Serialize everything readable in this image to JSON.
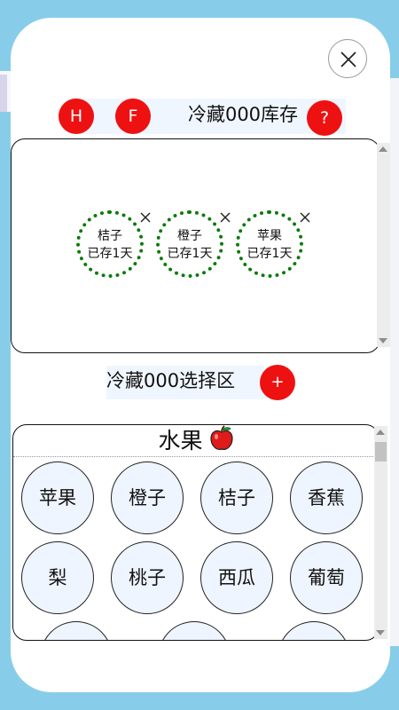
{
  "header": {
    "h_label": "H",
    "f_label": "F",
    "title": "冷藏000库存",
    "help_label": "?"
  },
  "inventory": {
    "items": [
      {
        "name": "桔子",
        "days": "已存1天"
      },
      {
        "name": "橙子",
        "days": "已存1天"
      },
      {
        "name": "苹果",
        "days": "已存1天"
      }
    ]
  },
  "selection": {
    "title": "冷藏000选择区",
    "add_label": "+",
    "category": "水果",
    "category_icon": "apple-icon",
    "fruits": [
      "苹果",
      "橙子",
      "桔子",
      "香蕉",
      "梨",
      "桃子",
      "西瓜",
      "葡萄",
      "",
      "",
      ""
    ]
  },
  "colors": {
    "accent_red": "#ee1111",
    "dotted_green": "#0c7a0c",
    "background": "#87cdea",
    "fruit_fill": "#eef5ff"
  }
}
